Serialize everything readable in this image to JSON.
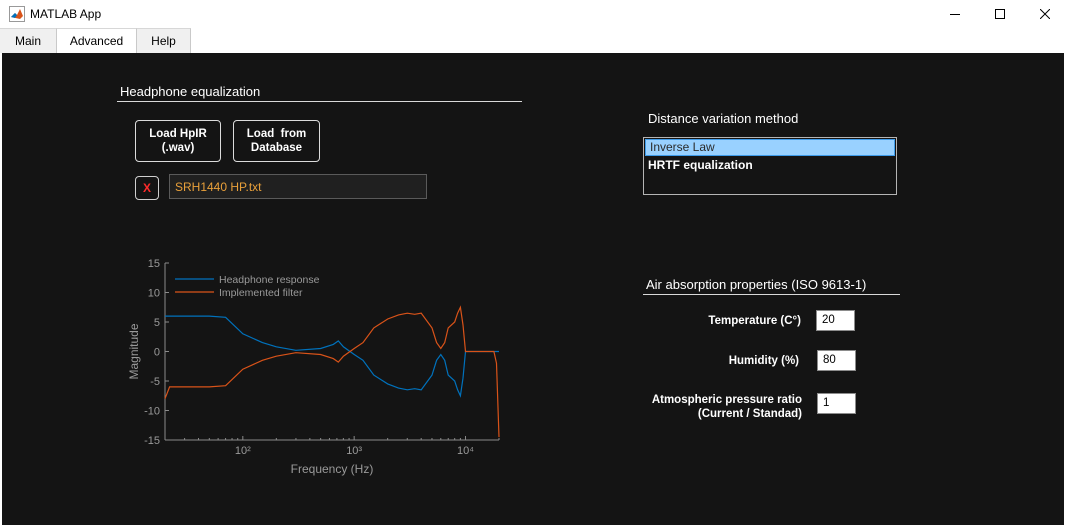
{
  "window": {
    "title": "MATLAB App",
    "icon": "matlab-logo-icon"
  },
  "tabs": [
    {
      "label": "Main"
    },
    {
      "label": "Advanced",
      "active": true
    },
    {
      "label": "Help"
    }
  ],
  "headphone_eq": {
    "heading": "Headphone equalization",
    "load_hpir_line1": "Load HpIR",
    "load_hpir_line2": "(.wav)",
    "load_db_line1": "Load  from",
    "load_db_line2": "Database",
    "clear_label": "X",
    "file_value": "SRH1440 HP.txt"
  },
  "distance": {
    "heading": "Distance variation method",
    "options": [
      "Inverse Law",
      "HRTF equalization"
    ],
    "selected": "Inverse Law"
  },
  "air": {
    "heading": "Air absorption properties (ISO 9613-1)",
    "temperature_label": "Temperature (C°)",
    "temperature_value": "20",
    "humidity_label": "Humidity (%)",
    "humidity_value": "80",
    "pressure_label_line1": "Atmospheric pressure ratio",
    "pressure_label_line2": "(Current / Standad)",
    "pressure_value": "1"
  },
  "colors": {
    "panel_bg": "#141414",
    "headphone_series": "#0072bd",
    "filter_series": "#d95319",
    "file_text": "#e9a03a",
    "clear_x": "#ff2b2b"
  },
  "chart_data": {
    "type": "line",
    "xlabel": "Frequency (Hz)",
    "ylabel": "Magnitude",
    "xscale": "log",
    "xlim": [
      20,
      20000
    ],
    "ylim": [
      -15,
      15
    ],
    "yticks": [
      15,
      10,
      5,
      0,
      -5,
      -10,
      -15
    ],
    "xtick_labels": [
      "10²",
      "10³",
      "10⁴"
    ],
    "legend_position": "top-left",
    "series": [
      {
        "name": "Headphone response",
        "x": [
          20,
          50,
          70,
          100,
          150,
          200,
          300,
          500,
          650,
          720,
          800,
          1000,
          1200,
          1500,
          2000,
          2500,
          3000,
          3500,
          4000,
          5000,
          5500,
          6000,
          6500,
          7000,
          8000,
          8500,
          9000,
          9500,
          10000,
          12000,
          14000,
          16000,
          18000,
          19000,
          20000
        ],
        "y": [
          6,
          6,
          5.8,
          3,
          1.5,
          0.8,
          0.2,
          0.5,
          1.2,
          1.8,
          0.8,
          -0.5,
          -1.5,
          -4,
          -5.5,
          -6.2,
          -6.5,
          -6.3,
          -6.5,
          -4,
          -1.5,
          -0.5,
          -1.5,
          -4,
          -5,
          -6.5,
          -7.5,
          -4.5,
          0,
          0,
          0,
          0,
          0,
          0,
          0
        ]
      },
      {
        "name": "Implemented filter",
        "x": [
          20,
          22,
          50,
          70,
          100,
          150,
          200,
          300,
          500,
          650,
          720,
          800,
          1000,
          1200,
          1500,
          2000,
          2500,
          3000,
          3500,
          4000,
          5000,
          5500,
          6000,
          6500,
          7000,
          8000,
          8500,
          9000,
          9500,
          10000,
          12000,
          14000,
          16000,
          18000,
          19000,
          20000
        ],
        "y": [
          -8,
          -6,
          -6,
          -5.8,
          -3,
          -1.5,
          -0.8,
          -0.2,
          -0.5,
          -1.2,
          -1.8,
          -0.8,
          0.5,
          1.5,
          4,
          5.5,
          6.2,
          6.5,
          6.3,
          6.5,
          4,
          1.5,
          0.5,
          1.5,
          4,
          5,
          6.5,
          7.5,
          4.5,
          0,
          0,
          0,
          0,
          0,
          -2,
          -14.5
        ]
      }
    ]
  }
}
